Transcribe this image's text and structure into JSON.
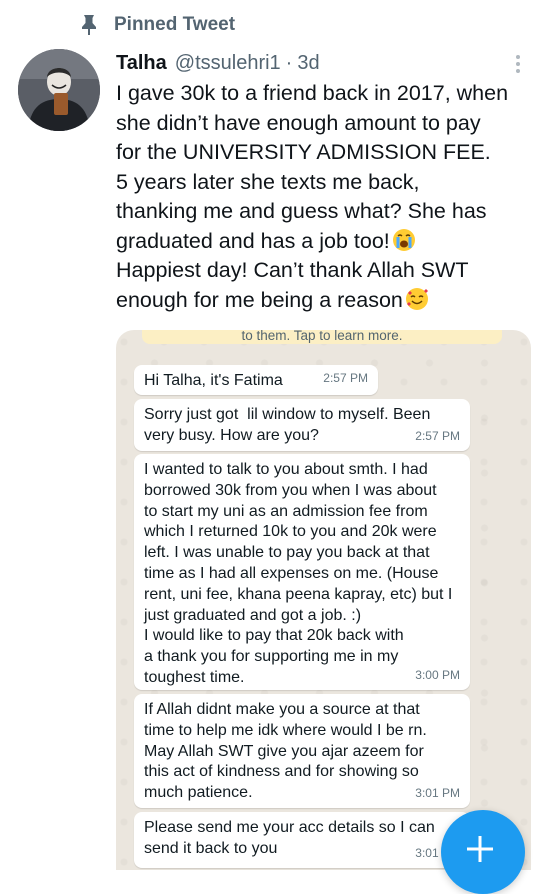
{
  "pinned": {
    "label": "Pinned Tweet",
    "icon": "pin-icon"
  },
  "tweet": {
    "author_name": "Talha",
    "handle": "@tssulehri1",
    "separator": "·",
    "time": "3d",
    "text_lines": [
      "I gave 30k to a friend back in 2017, when",
      "she didn’t have enough amount to pay",
      "for the UNIVERSITY ADMISSION FEE.",
      "5 years later she texts me back,",
      "thanking me and guess what? She has",
      "graduated and has a job too!",
      "Happiest day! Can’t thank Allah SWT",
      "enough for me being a reason"
    ],
    "emojis": [
      "loudly-crying-face-emoji",
      "smiling-face-with-hearts-emoji"
    ]
  },
  "chat": {
    "notice": "to them. Tap to learn more.",
    "messages": [
      {
        "text": "Hi Talha, it's Fatima",
        "time": "2:57 PM"
      },
      {
        "text": "Sorry just got  lil window to myself. Been\nvery busy. How are you?",
        "time": "2:57 PM"
      },
      {
        "text": "I wanted to talk to you about smth. I had\nborrowed 30k from you when I was about\nto start my uni as an admission fee from\nwhich I returned 10k to you and 20k were\nleft. I was unable to pay you back at that\ntime as I had all expenses on me. (House\nrent, uni fee, khana peena kapray, etc) but I\njust graduated and got a job. :)\nI would like to pay that 20k back with\na thank you for supporting me in my\ntoughest time.",
        "time": "3:00 PM"
      },
      {
        "text": "If Allah didnt make you a source at that\ntime to help me idk where would I be rn.\nMay Allah SWT give you ajar azeem for\nthis act of kindness and for showing so\nmuch patience.",
        "time": "3:01 PM"
      },
      {
        "text": "Please send me your acc details so I can\nsend it back to you",
        "time": "3:01 PM"
      }
    ]
  },
  "compose": {
    "icon": "plus-icon"
  },
  "colors": {
    "accent": "#1d9bf0",
    "muted": "#536471",
    "text": "#0f1419",
    "chat_bg": "#ebe6de"
  }
}
